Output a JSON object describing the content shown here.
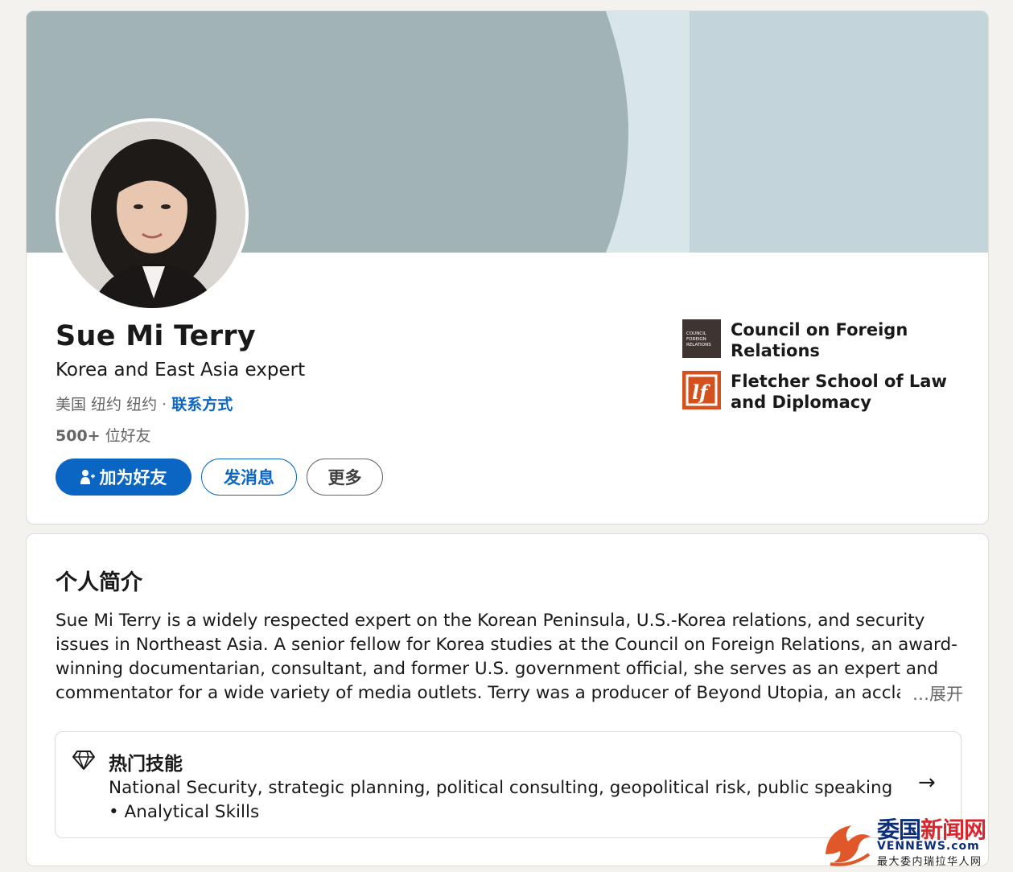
{
  "colors": {
    "accent": "#0a66c2",
    "page_background": "#f4f2ee",
    "banner_light": "#c3d5da",
    "banner_dark": "#a2b3b6",
    "fletcher_orange": "#d4511e",
    "cfr_brown": "#3e3430"
  },
  "profile": {
    "name": "Sue Mi Terry",
    "headline": "Korea and East Asia expert",
    "location": "美国 纽约 纽约",
    "separator": "·",
    "contact_info_label": "联系方式",
    "connections_count": "500+",
    "connections_label": "位好友",
    "actions": {
      "connect_label": "加为好友",
      "connect_icon": "add-person-icon",
      "message_label": "发消息",
      "more_label": "更多"
    },
    "organizations": [
      {
        "name": "Council on Foreign Relations",
        "logo_text": "COUNCIL on FOREIGN RELATIONS"
      },
      {
        "name": "Fletcher School of Law and Diplomacy",
        "logo_text": "lfl"
      }
    ]
  },
  "about": {
    "title": "个人简介",
    "lines": [
      "Sue Mi Terry is a widely respected expert on the Korean Peninsula, U.S.-Korea relations, and security",
      "issues in Northeast Asia. A senior fellow for Korea studies at the Council on Foreign Relations, an award-",
      "winning documentarian, consultant, and former U.S. government official, she serves as an expert and",
      "commentator for a wide variety of media outlets. Terry was a producer of Beyond Utopia, an acclai"
    ],
    "expand_label": "…展开",
    "top_skills": {
      "title": "热门技能",
      "icon": "diamond-icon",
      "text": "National Security, strategic planning, political consulting, geopolitical risk, public speaking • Analytical Skills",
      "arrow_icon": "arrow-right-icon"
    }
  },
  "watermark": {
    "title_part1": "委国",
    "title_part2": "新闻网",
    "subtitle": "VENNEWS.com",
    "caption": "最大委内瑞拉华人网"
  }
}
